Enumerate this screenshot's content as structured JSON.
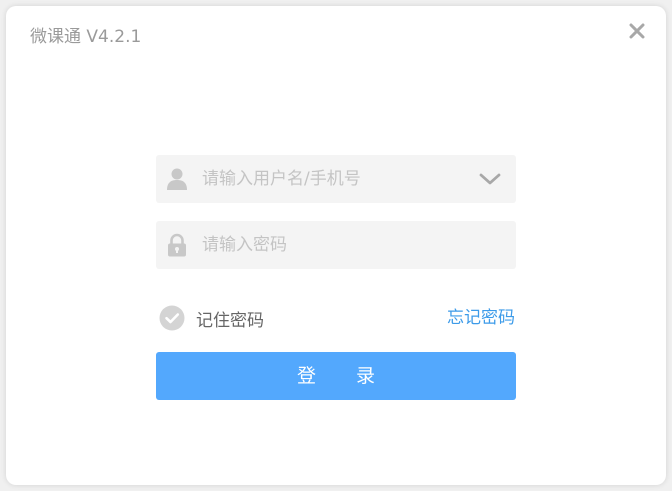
{
  "window": {
    "title": "微课通 V4.2.1"
  },
  "form": {
    "username": {
      "placeholder": "请输入用户名/手机号",
      "value": ""
    },
    "password": {
      "placeholder": "请输入密码",
      "value": ""
    },
    "remember_label": "记住密码",
    "remember_checked": false,
    "forgot_label": "忘记密码",
    "login_label": "登录"
  },
  "icons": {
    "close": "close-icon",
    "user": "user-icon",
    "lock": "lock-icon",
    "dropdown": "chevron-down-icon",
    "check": "check-circle-icon"
  },
  "colors": {
    "accent": "#53a8fd",
    "link": "#3d9be9",
    "field_bg": "#f4f4f4",
    "icon_gray": "#c8c8c8"
  }
}
